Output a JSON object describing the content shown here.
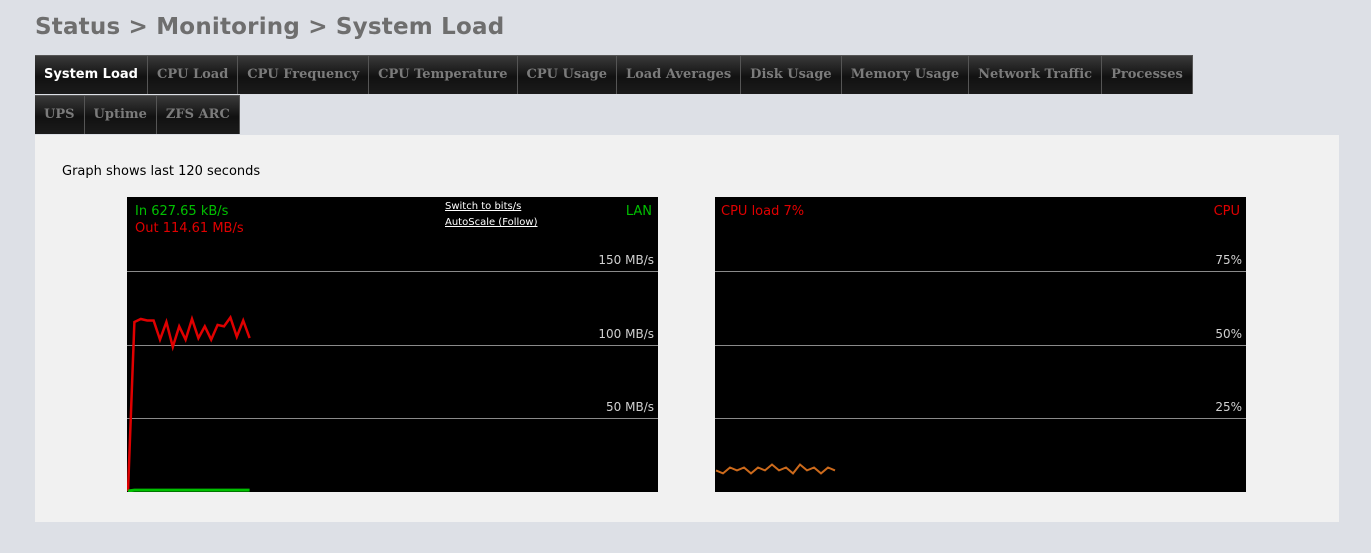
{
  "breadcrumb": "Status > Monitoring > System Load",
  "tabs_row1": [
    "System Load",
    "CPU Load",
    "CPU Frequency",
    "CPU Temperature",
    "CPU Usage",
    "Load Averages",
    "Disk Usage",
    "Memory Usage",
    "Network Traffic",
    "Processes"
  ],
  "tabs_row2": [
    "UPS",
    "Uptime",
    "ZFS ARC"
  ],
  "active_tab": "System Load",
  "caption": "Graph shows last 120 seconds",
  "network_graph": {
    "in_label": "In 627.65 kB/s",
    "out_label": "Out 114.61 MB/s",
    "name": "LAN",
    "switch_label": "Switch to bits/s",
    "autoscale_label": "AutoScale (Follow)",
    "ylabels": [
      "150 MB/s",
      "100 MB/s",
      "50 MB/s"
    ],
    "colors": {
      "in": "#00c000",
      "out": "#e00000"
    }
  },
  "cpu_graph": {
    "load_label": "CPU load 7%",
    "name": "CPU",
    "ylabels": [
      "75%",
      "50%",
      "25%"
    ],
    "color": "#cc6a1c"
  },
  "chart_data": [
    {
      "type": "line",
      "ylim": [
        0,
        200
      ],
      "series": [
        {
          "name": "In",
          "values": [
            0,
            0.6,
            0.6,
            0.6,
            0.6,
            0.6,
            0.6,
            0.6,
            0.6,
            0.6,
            0.6,
            0.6,
            0.6,
            0.6,
            0.6,
            0.6,
            0.6,
            0.6,
            0.6,
            0.6
          ]
        },
        {
          "name": "Out",
          "values": [
            0,
            115,
            117,
            116,
            116,
            103,
            115,
            98,
            112,
            103,
            117,
            104,
            112,
            103,
            113,
            112,
            118,
            105,
            116,
            104
          ]
        }
      ]
    },
    {
      "type": "line",
      "ylim": [
        0,
        100
      ],
      "series": [
        {
          "name": "CPU",
          "values": [
            7,
            6,
            8,
            7,
            8,
            6,
            8,
            7,
            9,
            7,
            8,
            6,
            9,
            7,
            8,
            6,
            8,
            7
          ]
        }
      ]
    }
  ]
}
